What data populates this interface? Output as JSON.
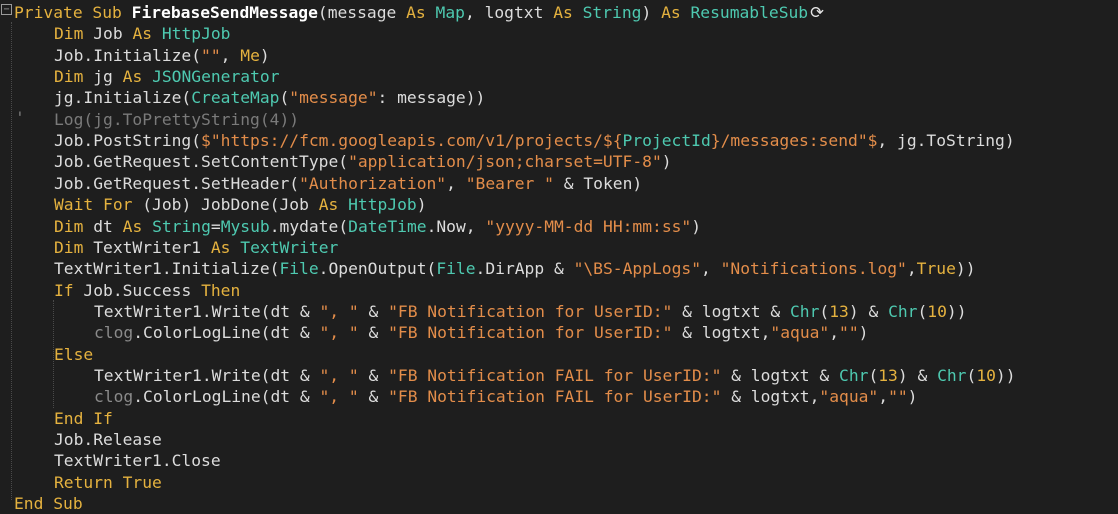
{
  "code": {
    "lines": [
      [
        [
          "kw",
          "Private Sub "
        ],
        [
          "bd",
          "FirebaseSendMessage"
        ],
        [
          "pl",
          "(message "
        ],
        [
          "kw",
          "As "
        ],
        [
          "ty",
          "Map"
        ],
        [
          "pl",
          ", logtxt "
        ],
        [
          "kw",
          "As "
        ],
        [
          "ty",
          "String"
        ],
        [
          "pl",
          ") "
        ],
        [
          "kw",
          "As "
        ],
        [
          "ty",
          "ResumableSub"
        ]
      ],
      [
        [
          "kw",
          "Dim "
        ],
        [
          "pl",
          "Job "
        ],
        [
          "kw",
          "As "
        ],
        [
          "ty",
          "HttpJob"
        ]
      ],
      [
        [
          "pl",
          "Job.Initialize("
        ],
        [
          "st",
          "\"\""
        ],
        [
          "pl",
          ", "
        ],
        [
          "kw",
          "Me"
        ],
        [
          "pl",
          ")"
        ]
      ],
      [
        [
          "kw",
          "Dim "
        ],
        [
          "pl",
          "jg "
        ],
        [
          "kw",
          "As "
        ],
        [
          "ty",
          "JSONGenerator"
        ]
      ],
      [
        [
          "pl",
          "jg.Initialize("
        ],
        [
          "ty",
          "CreateMap"
        ],
        [
          "pl",
          "("
        ],
        [
          "st",
          "\"message\""
        ],
        [
          "pl",
          ": message))"
        ]
      ],
      [
        [
          "cm",
          "Log(jg.ToPrettyString(4))"
        ]
      ],
      [
        [
          "pl",
          "Job.PostString("
        ],
        [
          "st",
          "$\"https://fcm.googleapis.com/v1/projects/${"
        ],
        [
          "ty",
          "ProjectId"
        ],
        [
          "st",
          "}/messages:send\"$"
        ],
        [
          "pl",
          ", jg.ToString)"
        ]
      ],
      [
        [
          "pl",
          "Job.GetRequest.SetContentType("
        ],
        [
          "st",
          "\"application/json;charset=UTF-8\""
        ],
        [
          "pl",
          ")"
        ]
      ],
      [
        [
          "pl",
          "Job.GetRequest.SetHeader("
        ],
        [
          "st",
          "\"Authorization\""
        ],
        [
          "pl",
          ", "
        ],
        [
          "st",
          "\"Bearer \""
        ],
        [
          "pl",
          " & Token)"
        ]
      ],
      [
        [
          "kw",
          "Wait For "
        ],
        [
          "pl",
          "(Job) JobDone(Job "
        ],
        [
          "kw",
          "As "
        ],
        [
          "ty",
          "HttpJob"
        ],
        [
          "pl",
          ")"
        ]
      ],
      [
        [
          "kw",
          "Dim "
        ],
        [
          "pl",
          "dt "
        ],
        [
          "kw",
          "As "
        ],
        [
          "ty",
          "String"
        ],
        [
          "pl",
          "="
        ],
        [
          "ty",
          "Mysub"
        ],
        [
          "pl",
          ".mydate("
        ],
        [
          "ty",
          "DateTime"
        ],
        [
          "pl",
          ".Now, "
        ],
        [
          "st",
          "\"yyyy-MM-dd HH:mm:ss\""
        ],
        [
          "pl",
          ")"
        ]
      ],
      [
        [
          "kw",
          "Dim "
        ],
        [
          "pl",
          "TextWriter1 "
        ],
        [
          "kw",
          "As "
        ],
        [
          "ty",
          "TextWriter"
        ]
      ],
      [
        [
          "pl",
          "TextWriter1.Initialize("
        ],
        [
          "ty",
          "File"
        ],
        [
          "pl",
          ".OpenOutput("
        ],
        [
          "ty",
          "File"
        ],
        [
          "pl",
          ".DirApp & "
        ],
        [
          "st",
          "\"\\BS-AppLogs\""
        ],
        [
          "pl",
          ", "
        ],
        [
          "st",
          "\"Notifications.log\""
        ],
        [
          "pl",
          ","
        ],
        [
          "kw",
          "True"
        ],
        [
          "pl",
          "))"
        ]
      ],
      [
        [
          "kw",
          "If "
        ],
        [
          "pl",
          "Job.Success "
        ],
        [
          "kw",
          "Then"
        ]
      ],
      [
        [
          "pl",
          "TextWriter1.Write(dt & "
        ],
        [
          "st",
          "\", \""
        ],
        [
          "pl",
          " & "
        ],
        [
          "st",
          "\"FB Notification for UserID:\""
        ],
        [
          "pl",
          " & logtxt & "
        ],
        [
          "ty",
          "Chr"
        ],
        [
          "pl",
          "("
        ],
        [
          "kw",
          "13"
        ],
        [
          "pl",
          ") & "
        ],
        [
          "ty",
          "Chr"
        ],
        [
          "pl",
          "("
        ],
        [
          "kw",
          "10"
        ],
        [
          "pl",
          "))"
        ]
      ],
      [
        [
          "cq",
          "clog"
        ],
        [
          "pl",
          ".ColorLogLine(dt & "
        ],
        [
          "st",
          "\", \""
        ],
        [
          "pl",
          " & "
        ],
        [
          "st",
          "\"FB Notification for UserID:\""
        ],
        [
          "pl",
          " & logtxt,"
        ],
        [
          "st",
          "\"aqua\""
        ],
        [
          "pl",
          ","
        ],
        [
          "st",
          "\"\""
        ],
        [
          "pl",
          ")"
        ]
      ],
      [
        [
          "kw",
          "Else"
        ]
      ],
      [
        [
          "pl",
          "TextWriter1.Write(dt & "
        ],
        [
          "st",
          "\", \""
        ],
        [
          "pl",
          " & "
        ],
        [
          "st",
          "\"FB Notification FAIL for UserID:\""
        ],
        [
          "pl",
          " & logtxt & "
        ],
        [
          "ty",
          "Chr"
        ],
        [
          "pl",
          "("
        ],
        [
          "kw",
          "13"
        ],
        [
          "pl",
          ") & "
        ],
        [
          "ty",
          "Chr"
        ],
        [
          "pl",
          "("
        ],
        [
          "kw",
          "10"
        ],
        [
          "pl",
          "))"
        ]
      ],
      [
        [
          "cq",
          "clog"
        ],
        [
          "pl",
          ".ColorLogLine(dt & "
        ],
        [
          "st",
          "\", \""
        ],
        [
          "pl",
          " & "
        ],
        [
          "st",
          "\"FB Notification FAIL for UserID:\""
        ],
        [
          "pl",
          " & logtxt,"
        ],
        [
          "st",
          "\"aqua\""
        ],
        [
          "pl",
          ","
        ],
        [
          "st",
          "\"\""
        ],
        [
          "pl",
          ")"
        ]
      ],
      [
        [
          "kw",
          "End If"
        ]
      ],
      [
        [
          "pl",
          "Job.Release"
        ]
      ],
      [
        [
          "pl",
          "TextWriter1.Close"
        ]
      ],
      [
        [
          "kw",
          "Return True"
        ]
      ],
      [
        [
          "kw",
          "End Sub"
        ]
      ]
    ],
    "comment_marker": "'",
    "fold_glyph": "−",
    "resumable_marker_glyph": "⟳"
  },
  "colors": {
    "background": "#1e1e1e",
    "keyword": "#e5b23f",
    "type": "#4ec9b0",
    "string": "#e38d4a",
    "plain": "#dcdcdc",
    "comment": "#7a7a7a"
  }
}
